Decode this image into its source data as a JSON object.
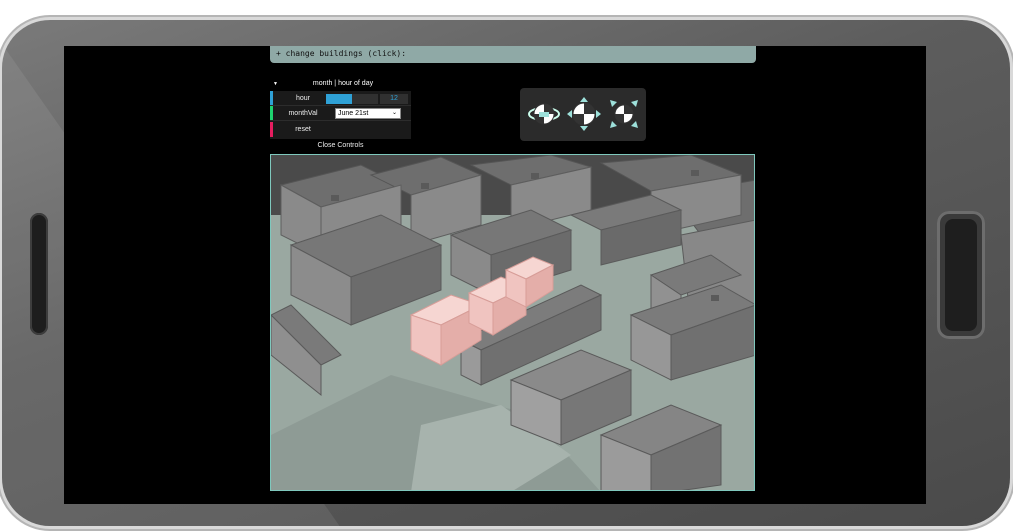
{
  "banner": {
    "text": "+ change buildings (click):"
  },
  "gui": {
    "title": "month | hour of day",
    "hour": {
      "label": "hour",
      "value": "12",
      "fill_fraction": 0.5
    },
    "month": {
      "label": "monthVal",
      "selected": "June 21st"
    },
    "reset": {
      "label": "reset"
    },
    "close_label": "Close Controls",
    "colors": {
      "hour_bar": "#2fa1d6",
      "month_bar": "#1ed36f",
      "reset_bar": "#e61d5f",
      "slider_fill": "#2fa1d6"
    }
  },
  "nav_icons": [
    "orbit-icon",
    "pan-icon",
    "zoom-icon"
  ],
  "viewport": {
    "description_color_buildings": "#808080",
    "highlight_color": "#f0c4c0",
    "ground_color": "#9aa8a1"
  }
}
